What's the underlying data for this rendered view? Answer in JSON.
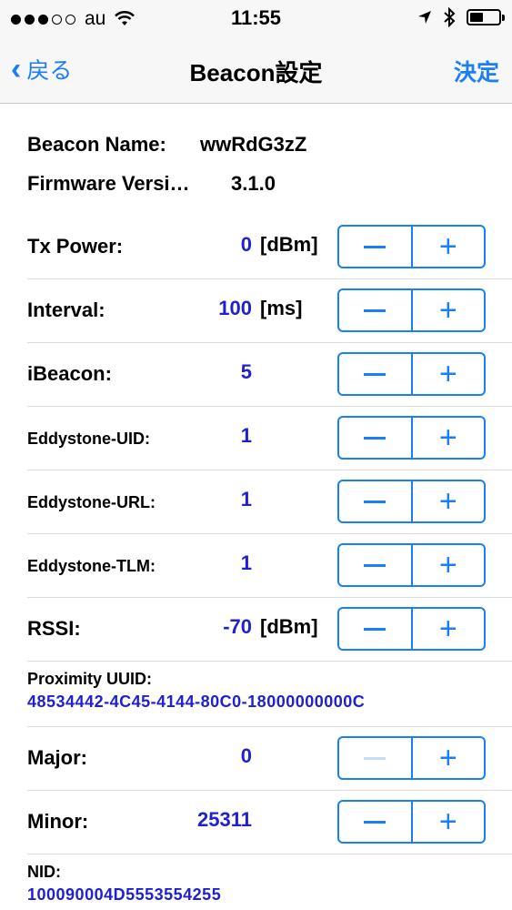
{
  "status_bar": {
    "carrier": "au",
    "time": "11:55"
  },
  "nav": {
    "back_label": "戻る",
    "title": "Beacon設定",
    "done_label": "決定"
  },
  "info": {
    "beacon_name_label": "Beacon Name:",
    "beacon_name_value": "wwRdG3zZ",
    "firmware_label": "Firmware Versi…",
    "firmware_value": "3.1.0"
  },
  "settings": [
    {
      "label": "Tx Power:",
      "value": "0",
      "unit": "[dBm]"
    },
    {
      "label": "Interval:",
      "value": "100",
      "unit": "[ms]"
    },
    {
      "label": "iBeacon:",
      "value": "5",
      "unit": ""
    },
    {
      "label": "Eddystone-UID:",
      "value": "1",
      "unit": ""
    },
    {
      "label": "Eddystone-URL:",
      "value": "1",
      "unit": ""
    },
    {
      "label": "Eddystone-TLM:",
      "value": "1",
      "unit": ""
    },
    {
      "label": "RSSI:",
      "value": "-70",
      "unit": "[dBm]"
    }
  ],
  "proximity_uuid": {
    "label": "Proximity UUID:",
    "value": "48534442-4C45-4144-80C0-18000000000C"
  },
  "major": {
    "label": "Major:",
    "value": "0"
  },
  "minor": {
    "label": "Minor:",
    "value": "25311"
  },
  "nid": {
    "label": "NID:",
    "value": "100090004D5553554255"
  },
  "colors": {
    "accent": "#1a7ef8",
    "value_text": "#2020d0"
  }
}
